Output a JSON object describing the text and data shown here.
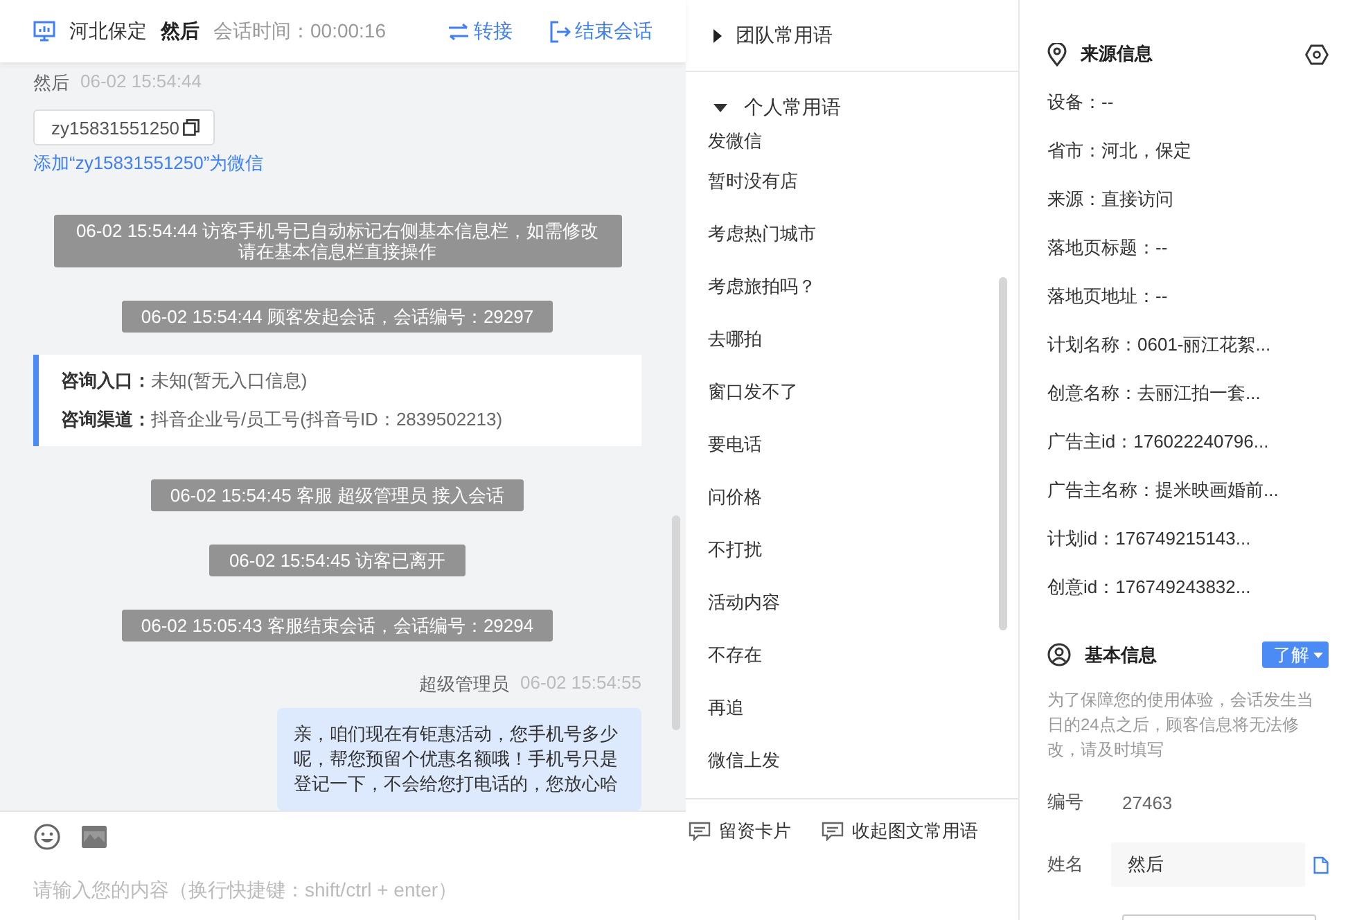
{
  "header": {
    "location": "河北保定",
    "visitor": "然后",
    "duration": "会话时间：00:00:16",
    "actions": [
      {
        "kind": "transfer",
        "label": "转接"
      },
      {
        "kind": "end",
        "label": "结束会话"
      }
    ]
  },
  "messages": [
    {
      "kind": "visitor",
      "name": "然后",
      "time": "06-02 15:54:44",
      "card": "zy15831551250",
      "link": "添加“zy15831551250”为微信"
    },
    {
      "kind": "system",
      "text": "06-02 15:54:44 访客手机号已自动标记右侧基本信息栏，如需修改请在基本信息栏直接操作"
    },
    {
      "kind": "system",
      "text": "06-02 15:54:44 顾客发起会话，会话编号：29297"
    },
    {
      "kind": "info",
      "rows": [
        {
          "label": "咨询入口：",
          "value": "未知(暂无入口信息)"
        },
        {
          "label": "咨询渠道：",
          "value": "抖音企业号/员工号(抖音号ID：2839502213)"
        }
      ]
    },
    {
      "kind": "system",
      "text": "06-02 15:54:45 客服 超级管理员 接入会话"
    },
    {
      "kind": "system",
      "text": "06-02 15:54:45 访客已离开"
    },
    {
      "kind": "system",
      "text": "06-02 15:05:43 客服结束会话，会话编号：29294"
    },
    {
      "kind": "agent",
      "name": "超级管理员",
      "time": "06-02 15:54:55",
      "text": "亲，咱们现在有钜惠活动，您手机号多少呢，帮您预留个优惠名额哦！手机号只是登记一下，不会给您打电话的，您放心哈"
    }
  ],
  "composer": {
    "placeholder": "请输入您的内容（换行快捷键：shift/ctrl + enter）"
  },
  "phrases": {
    "groups": [
      {
        "title": "团队常用语",
        "expanded": false
      },
      {
        "title": "个人常用语",
        "expanded": true,
        "items": [
          "发微信",
          "暂时没有店",
          "考虑热门城市",
          "考虑旅拍吗？",
          "去哪拍",
          "窗口发不了",
          "要电话",
          "问价格",
          "不打扰",
          "活动内容",
          "不存在",
          "再追",
          "微信上发"
        ]
      }
    ],
    "footer": [
      "留资卡片",
      "收起图文常用语"
    ]
  },
  "source": {
    "title": "来源信息",
    "rows": [
      "设备：--",
      "省市：河北，保定",
      "来源：直接访问",
      "落地页标题：--",
      "落地页地址：--",
      "计划名称：0601-丽江花絮...",
      "创意名称：去丽江拍一套...",
      "广告主id：176022240796...",
      "广告主名称：提米映画婚前...",
      "计划id：176749215143...",
      "创意id：176749243832..."
    ]
  },
  "basic": {
    "title": "基本信息",
    "dropdown": "了解",
    "note": "为了保障您的使用体验，会话发生当日的24点之后，顾客信息将无法修改，请及时填写",
    "fields": [
      {
        "kind": "text",
        "label": "编号",
        "value": "27463"
      },
      {
        "kind": "input",
        "label": "姓名",
        "value": "然后"
      },
      {
        "kind": "input"
      }
    ]
  }
}
